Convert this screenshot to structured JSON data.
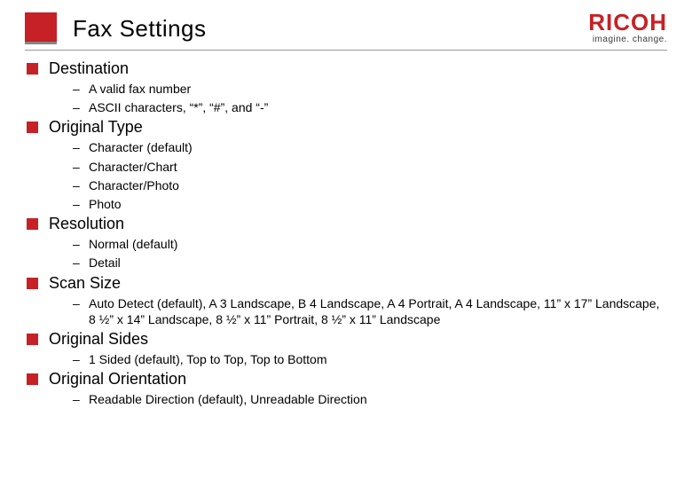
{
  "title": "Fax Settings",
  "logo": {
    "word": "RICOH",
    "tagline": "imagine. change."
  },
  "sections": [
    {
      "title": "Destination",
      "items": [
        "A valid fax number",
        "ASCII characters, “*”, “#”, and “-”"
      ]
    },
    {
      "title": "Original Type",
      "items": [
        "Character (default)",
        "Character/Chart",
        "Character/Photo",
        "Photo"
      ]
    },
    {
      "title": "Resolution",
      "items": [
        "Normal (default)",
        "Detail"
      ]
    },
    {
      "title": "Scan Size",
      "items": [
        "Auto Detect (default), A 3 Landscape, B 4 Landscape, A 4 Portrait, A 4 Landscape, 11” x 17” Landscape, 8 ½” x 14” Landscape, 8 ½” x 11” Portrait, 8 ½” x 11” Landscape"
      ]
    },
    {
      "title": "Original Sides",
      "items": [
        "1 Sided (default), Top to Top, Top to Bottom"
      ]
    },
    {
      "title": "Original Orientation",
      "items": [
        "Readable Direction (default), Unreadable Direction"
      ]
    }
  ]
}
